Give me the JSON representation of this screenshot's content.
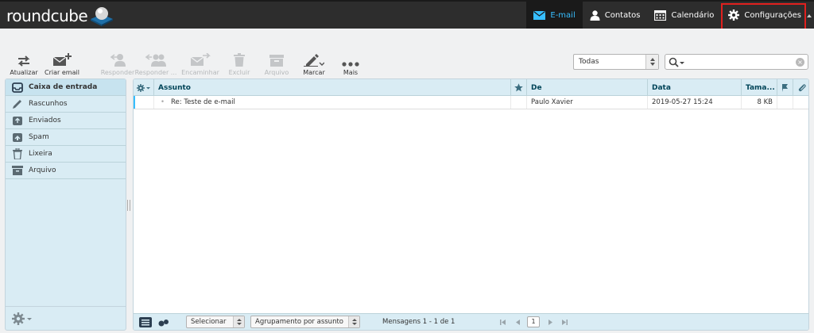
{
  "app": {
    "logo_text": "roundcube"
  },
  "topnav": {
    "items": [
      {
        "label": "E-mail",
        "icon": "envelope-icon",
        "active": true
      },
      {
        "label": "Contatos",
        "icon": "person-icon"
      },
      {
        "label": "Calendário",
        "icon": "calendar-icon"
      },
      {
        "label": "Configurações",
        "icon": "gear-icon",
        "highlighted": true
      }
    ]
  },
  "toolbar": {
    "buttons": [
      {
        "label": "Atualizar",
        "icon": "refresh-icon",
        "enabled": true
      },
      {
        "label": "Criar email",
        "icon": "compose-icon",
        "enabled": true
      },
      {
        "label": "Responder",
        "icon": "reply-icon",
        "enabled": false
      },
      {
        "label": "Responder ...",
        "icon": "reply-all-icon",
        "enabled": false
      },
      {
        "label": "Encaminhar",
        "icon": "forward-icon",
        "enabled": false
      },
      {
        "label": "Excluir",
        "icon": "trash-icon",
        "enabled": false
      },
      {
        "label": "Arquivo",
        "icon": "archive-icon",
        "enabled": false
      },
      {
        "label": "Marcar",
        "icon": "mark-icon",
        "enabled": true
      },
      {
        "label": "Mais",
        "icon": "more-icon",
        "enabled": true
      }
    ],
    "filter_value": "Todas"
  },
  "folders": [
    {
      "label": "Caixa de entrada",
      "icon": "inbox-icon",
      "selected": true
    },
    {
      "label": "Rascunhos",
      "icon": "pencil-icon"
    },
    {
      "label": "Enviados",
      "icon": "sent-icon"
    },
    {
      "label": "Spam",
      "icon": "spam-icon"
    },
    {
      "label": "Lixeira",
      "icon": "trash-icon"
    },
    {
      "label": "Arquivo",
      "icon": "archive-icon"
    }
  ],
  "messages": {
    "columns": {
      "subject": "Assunto",
      "from": "De",
      "date": "Data",
      "size": "Tama..."
    },
    "rows": [
      {
        "subject": "Re: Teste de e-mail",
        "from": "Paulo Xavier",
        "date": "2019-05-27 15:24",
        "size": "8 KB"
      }
    ],
    "footer": {
      "select_label": "Selecionar",
      "threading_label": "Agrupamento por assunto",
      "count_text": "Mensagens 1 - 1 de 1",
      "page": "1"
    }
  },
  "colors": {
    "accent": "#37beff",
    "highlight": "#e0201e",
    "panel": "#d9ecf4"
  }
}
